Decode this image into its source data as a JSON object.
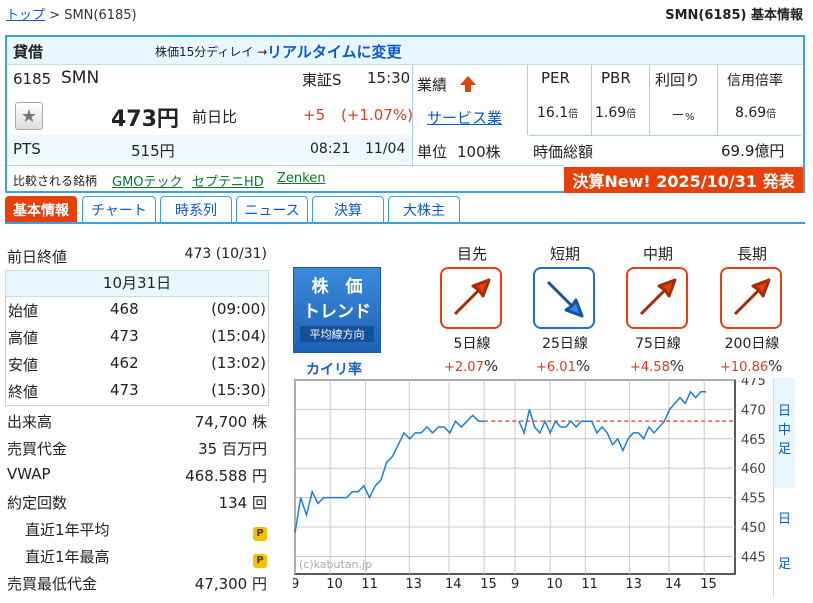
{
  "breadcrumb": {
    "top": "トップ",
    "sep": ">",
    "current": "SMN(6185)"
  },
  "page_title": "SMN(6185) 基本情報",
  "header": {
    "margin_label": "貸借",
    "delay_note": "株価15分ディレイ →",
    "realtime_link": "リアルタイムに変更"
  },
  "stock": {
    "code": "6185",
    "name": "SMN",
    "market": "東証S",
    "time": "15:30",
    "price": "473円",
    "change_label": "前日比",
    "change": "+5",
    "change_pct": "(+1.07%)",
    "pts_label": "PTS",
    "pts_price": "515円",
    "pts_time": "08:21",
    "pts_date": "11/04"
  },
  "industry": {
    "label": "業績",
    "sector_link": "サービス業",
    "unit_label": "単位",
    "unit_value": "100株"
  },
  "metrics": {
    "per_label": "PER",
    "pbr_label": "PBR",
    "yield_label": "利回り",
    "margin_label": "信用倍率",
    "per": "16.1",
    "per_unit": "倍",
    "pbr": "1.69",
    "pbr_unit": "倍",
    "yield": "－",
    "yield_unit": "%",
    "margin_ratio": "8.69",
    "margin_unit": "倍",
    "mcap_label": "時価総額",
    "mcap": "69.9億円"
  },
  "compare": {
    "label": "比較される銘柄",
    "items": [
      "GMOテック",
      "セプテニHD",
      "Zenken"
    ]
  },
  "kessan_banner": "決算New!  2025/10/31  発表",
  "tabs": [
    "基本情報",
    "チャート",
    "時系列",
    "ニュース",
    "決算",
    "大株主"
  ],
  "summary": {
    "prev_close_label": "前日終値",
    "prev_close": "473 (10/31)",
    "date": "10月31日",
    "ohlc": [
      {
        "label": "始値",
        "value": "468",
        "time": "(09:00)"
      },
      {
        "label": "高値",
        "value": "473",
        "time": "(15:04)"
      },
      {
        "label": "安値",
        "value": "462",
        "time": "(13:02)"
      },
      {
        "label": "終値",
        "value": "473",
        "time": "(15:30)"
      }
    ],
    "stats": [
      {
        "label": "出来高",
        "value": "74,700 株"
      },
      {
        "label": "売買代金",
        "value": "35 百万円"
      },
      {
        "label": "VWAP",
        "value": "468.588 円"
      },
      {
        "label": "約定回数",
        "value": "134 回"
      }
    ],
    "locked": [
      {
        "label": "直近1年平均"
      },
      {
        "label": "直近1年最高"
      }
    ],
    "min_buy_label": "売買最低代金",
    "min_buy": "47,300 円"
  },
  "trend": {
    "title1": "株　価",
    "title2": "トレンド",
    "subtitle": "平均線方向",
    "kairi": "カイリ率",
    "columns": [
      {
        "term": "目先",
        "line": "5日線",
        "sign": "+2.07",
        "pct": "%",
        "dir": "up"
      },
      {
        "term": "短期",
        "line": "25日線",
        "sign": "+6.01",
        "pct": "%",
        "dir": "down"
      },
      {
        "term": "中期",
        "line": "75日線",
        "sign": "+4.58",
        "pct": "%",
        "dir": "up"
      },
      {
        "term": "長期",
        "line": "200日線",
        "sign": "+10.86",
        "pct": "%",
        "dir": "up"
      }
    ]
  },
  "chart_data": {
    "type": "line",
    "watermark": "(c)kabutan.jp",
    "y_ticks": [
      445,
      450,
      455,
      460,
      465,
      470,
      475
    ],
    "ylim": [
      442,
      475
    ],
    "x_ticks_day1": [
      "9",
      "10",
      "11",
      "13",
      "14",
      "15"
    ],
    "x_ticks_day2": [
      "9",
      "10",
      "11",
      "13",
      "14",
      "15"
    ],
    "prev_close": 468,
    "side_label_top": [
      "日",
      "中",
      "足"
    ],
    "side_label_bottom": [
      "日",
      "足"
    ],
    "day1": [
      449,
      455,
      452,
      456,
      454,
      455,
      455,
      455,
      455,
      455,
      456,
      456,
      457,
      455,
      457,
      458,
      461,
      462,
      464,
      466,
      465,
      466,
      466,
      467,
      466,
      467,
      467,
      466,
      468,
      467,
      468,
      469,
      468,
      468
    ],
    "day2": [
      468,
      466,
      470,
      467,
      466,
      468,
      466,
      468,
      467,
      467,
      468,
      467,
      468,
      468,
      468,
      466,
      467,
      466,
      464,
      465,
      463,
      465,
      466,
      466,
      465,
      467,
      466,
      467,
      468,
      470,
      471,
      472,
      471,
      473,
      472,
      473,
      473
    ]
  }
}
